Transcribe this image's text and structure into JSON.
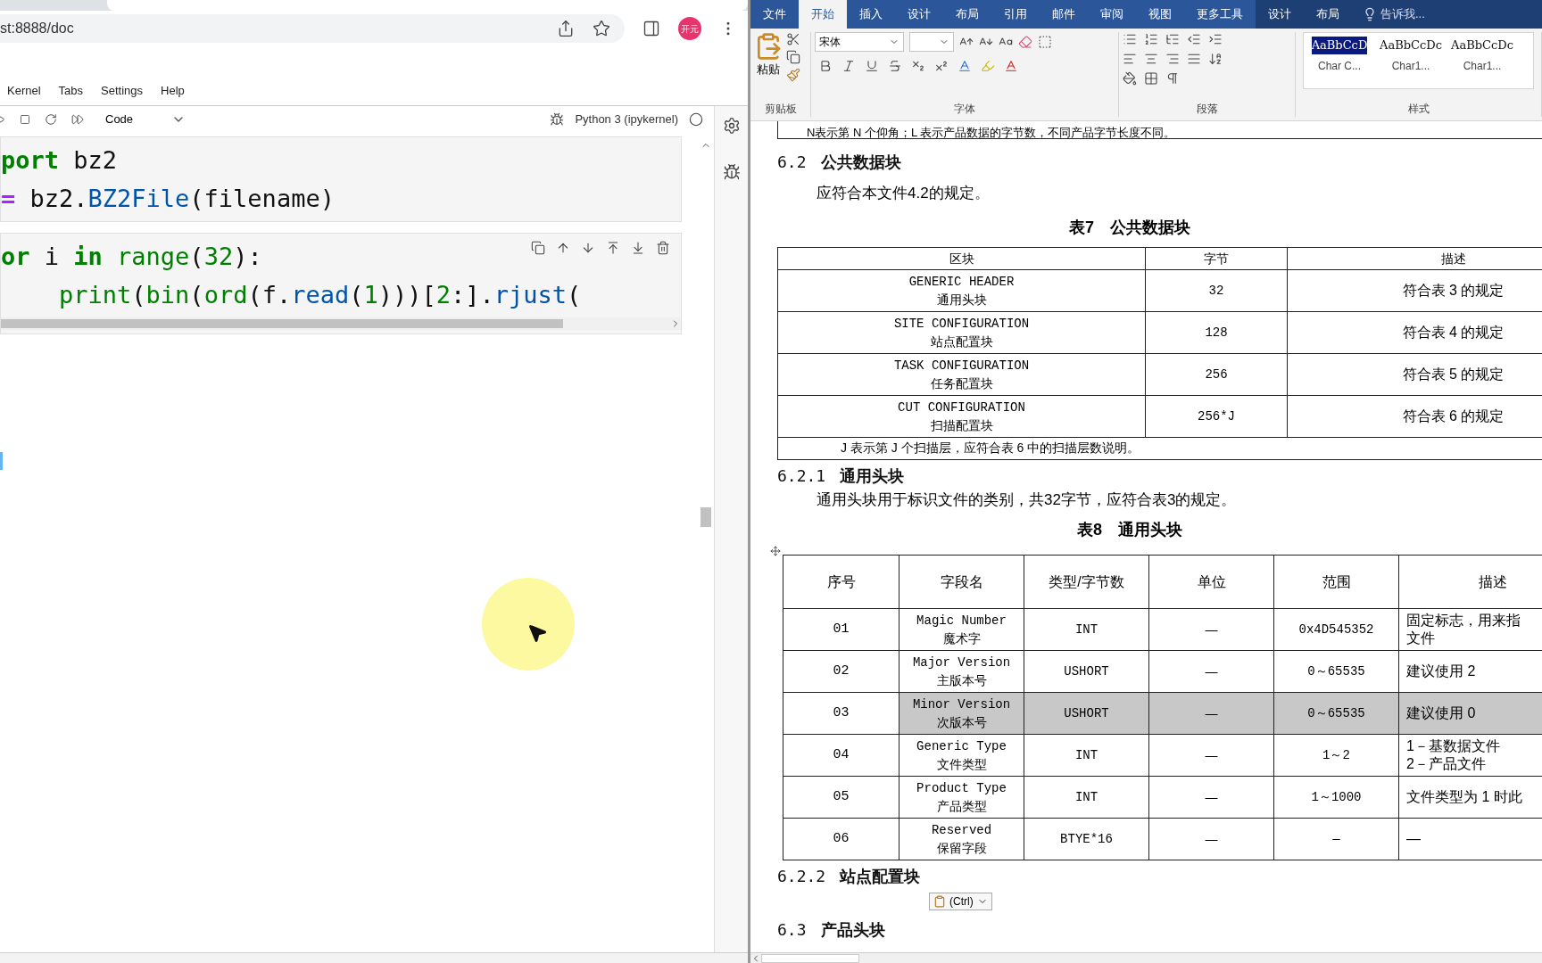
{
  "browser": {
    "url": "st:8888/doc",
    "profile": "开元"
  },
  "jupyter": {
    "menu": [
      "Kernel",
      "Tabs",
      "Settings",
      "Help"
    ],
    "cell_type": "Code",
    "kernel": "Python 3 (ipykernel)",
    "cells": [
      {
        "lines": [
          [
            {
              "text": "port",
              "kind": "kw"
            },
            {
              "text": " bz2",
              "kind": "plain"
            }
          ],
          [
            {
              "text": "=",
              "kind": "op"
            },
            {
              "text": " bz2.",
              "kind": "plain"
            },
            {
              "text": "BZ2File",
              "kind": "attr"
            },
            {
              "text": "(filename)",
              "kind": "plain"
            }
          ]
        ]
      },
      {
        "lines": [
          [
            {
              "text": "or",
              "kind": "kw"
            },
            {
              "text": " i ",
              "kind": "plain"
            },
            {
              "text": "in",
              "kind": "kw"
            },
            {
              "text": " range",
              "kind": "builtin"
            },
            {
              "text": "(",
              "kind": "plain"
            },
            {
              "text": "32",
              "kind": "num"
            },
            {
              "text": "):",
              "kind": "plain"
            }
          ],
          [
            {
              "text": "    print",
              "kind": "builtin"
            },
            {
              "text": "(",
              "kind": "plain"
            },
            {
              "text": "bin",
              "kind": "builtin"
            },
            {
              "text": "(",
              "kind": "plain"
            },
            {
              "text": "ord",
              "kind": "builtin"
            },
            {
              "text": "(f.",
              "kind": "plain"
            },
            {
              "text": "read",
              "kind": "attr"
            },
            {
              "text": "(",
              "kind": "plain"
            },
            {
              "text": "1",
              "kind": "num"
            },
            {
              "text": ")))[",
              "kind": "plain"
            },
            {
              "text": "2",
              "kind": "num"
            },
            {
              "text": ":].",
              "kind": "plain"
            },
            {
              "text": "rjust",
              "kind": "attr"
            },
            {
              "text": "(",
              "kind": "plain"
            }
          ]
        ]
      }
    ]
  },
  "word": {
    "tabs": [
      {
        "label": "文件",
        "selected": false,
        "contextual": false
      },
      {
        "label": "开始",
        "selected": true,
        "contextual": false
      },
      {
        "label": "插入",
        "selected": false,
        "contextual": false
      },
      {
        "label": "设计",
        "selected": false,
        "contextual": false
      },
      {
        "label": "布局",
        "selected": false,
        "contextual": false
      },
      {
        "label": "引用",
        "selected": false,
        "contextual": false
      },
      {
        "label": "邮件",
        "selected": false,
        "contextual": false
      },
      {
        "label": "审阅",
        "selected": false,
        "contextual": false
      },
      {
        "label": "视图",
        "selected": false,
        "contextual": false
      },
      {
        "label": "更多工具",
        "selected": false,
        "contextual": false
      },
      {
        "label": "设计",
        "selected": false,
        "contextual": true
      },
      {
        "label": "布局",
        "selected": false,
        "contextual": true
      }
    ],
    "tell_me": "告诉我...",
    "ribbon": {
      "paste": "粘贴",
      "font_name": "宋体",
      "groups": [
        "剪贴板",
        "字体",
        "段落",
        "样式"
      ],
      "styles": [
        {
          "preview": "AaBbCcD",
          "name": "Char C...",
          "selected": true
        },
        {
          "preview": "AaBbCcDc",
          "name": "Char1...",
          "selected": false
        },
        {
          "preview": "AaBbCcDc",
          "name": "Char1...",
          "selected": false
        }
      ]
    },
    "document": {
      "top_note": "N表示第 N 个仰角；L 表示产品数据的字节数，不同产品字节长度不同。",
      "h_6_2": {
        "number": "6.2",
        "title": "公共数据块"
      },
      "p_6_2": "应符合本文件4.2的规定。",
      "table7": {
        "caption": "表7　公共数据块",
        "columns": [
          "区块",
          "字节",
          "描述"
        ],
        "rows": [
          {
            "name_en": "GENERIC HEADER",
            "name_zh": "通用头块",
            "bytes": "32",
            "desc": "符合表 3 的规定"
          },
          {
            "name_en": "SITE CONFIGURATION",
            "name_zh": "站点配置块",
            "bytes": "128",
            "desc": "符合表 4 的规定"
          },
          {
            "name_en": "TASK CONFIGURATION",
            "name_zh": "任务配置块",
            "bytes": "256",
            "desc": "符合表 5 的规定"
          },
          {
            "name_en": "CUT CONFIGURATION",
            "name_zh": "扫描配置块",
            "bytes": "256*J",
            "desc": "符合表 6 的规定"
          }
        ],
        "note": "J 表示第 J 个扫描层，应符合表 6 中的扫描层数说明。"
      },
      "h_6_2_1": {
        "number": "6.2.1",
        "title": "通用头块"
      },
      "p_6_2_1": "通用头块用于标识文件的类别，共32字节，应符合表3的规定。",
      "table8": {
        "caption": "表8　通用头块",
        "columns": [
          "序号",
          "字段名",
          "类型/字节数",
          "单位",
          "范围",
          "描述"
        ],
        "rows": [
          {
            "no": "01",
            "field_en": "Magic Number",
            "field_zh": "魔术字",
            "type": "INT",
            "unit": "—",
            "range": "0x4D545352",
            "desc": [
              "固定标志，用来指",
              "文件"
            ],
            "selected": false
          },
          {
            "no": "02",
            "field_en": "Major Version",
            "field_zh": "主版本号",
            "type": "USHORT",
            "unit": "—",
            "range": "0～65535",
            "desc": [
              "建议使用 2"
            ],
            "selected": false
          },
          {
            "no": "03",
            "field_en": "Minor Version",
            "field_zh": "次版本号",
            "type": "USHORT",
            "unit": "—",
            "range": "0～65535",
            "desc": [
              "建议使用 0"
            ],
            "selected": true
          },
          {
            "no": "04",
            "field_en": "Generic Type",
            "field_zh": "文件类型",
            "type": "INT",
            "unit": "—",
            "range": "1～2",
            "desc": [
              "1－基数据文件",
              "2－产品文件"
            ],
            "selected": false
          },
          {
            "no": "05",
            "field_en": "Product Type",
            "field_zh": "产品类型",
            "type": "INT",
            "unit": "—",
            "range": "1～1000",
            "desc": [
              "文件类型为 1 时此"
            ],
            "selected": false
          },
          {
            "no": "06",
            "field_en": "Reserved",
            "field_zh": "保留字段",
            "type": "BTYE*16",
            "unit": "—",
            "range": "—",
            "desc": [
              "—"
            ],
            "selected": false
          }
        ]
      },
      "h_6_2_2": {
        "number": "6.2.2",
        "title": "站点配置块"
      },
      "paste_options": "(Ctrl)",
      "h_6_3": {
        "number": "6.3",
        "title": "产品头块"
      }
    }
  }
}
